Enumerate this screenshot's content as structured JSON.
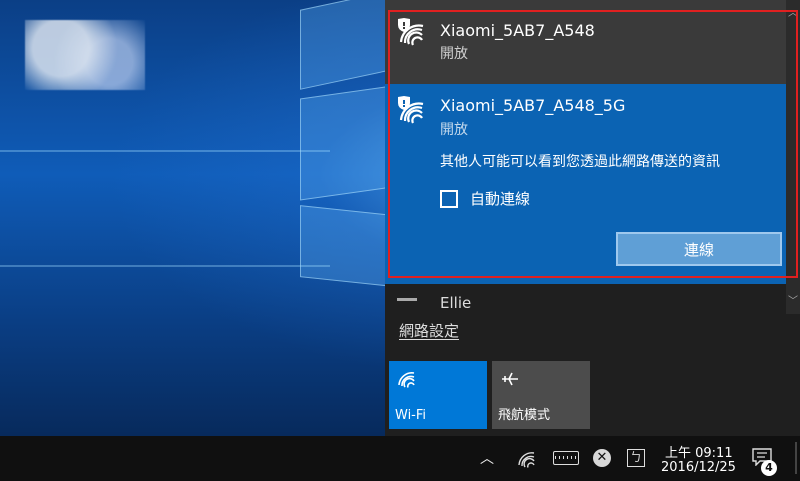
{
  "networks": [
    {
      "ssid": "Xiaomi_5AB7_A548",
      "status": "開放",
      "icon": "wifi-secured-icon"
    },
    {
      "ssid": "Xiaomi_5AB7_A548_5G",
      "status": "開放",
      "icon": "wifi-secured-icon",
      "warning": "其他人可能可以看到您透過此網路傳送的資訊",
      "auto_connect_label": "自動連線",
      "auto_connect_checked": false,
      "connect_label": "連線"
    },
    {
      "ssid": "Ellie",
      "partial": true
    }
  ],
  "network_settings_label": "網路設定",
  "quick_actions": {
    "wifi_label": "Wi-Fi",
    "airplane_label": "飛航模式"
  },
  "taskbar": {
    "time": "上午 09:11",
    "date": "2016/12/25",
    "notification_count": "4"
  },
  "colors": {
    "accent": "#0078d7",
    "selected_network_bg": "#0b63b3",
    "highlight_border": "#e02020",
    "flyout_bg": "#1f1f1f"
  }
}
